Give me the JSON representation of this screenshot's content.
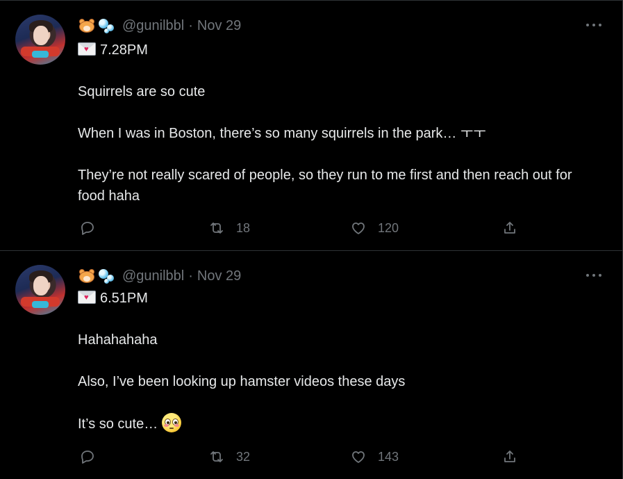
{
  "tweets": [
    {
      "handle": "@gunilbbl",
      "separator": "·",
      "date": "Nov 29",
      "time_label": "7.28PM",
      "lines": [
        "Squirrels are so cute",
        "When I was in Boston, there’s so many squirrels in the park… ㅜㅜ",
        "They’re not really scared of people, so they run to me first and then reach out for food haha"
      ],
      "retweets": "18",
      "likes": "120"
    },
    {
      "handle": "@gunilbbl",
      "separator": "·",
      "date": "Nov 29",
      "time_label": "6.51PM",
      "lines": [
        "Hahahahaha",
        "Also, I’ve been looking up hamster videos these days",
        "It’s so cute…"
      ],
      "retweets": "32",
      "likes": "143"
    }
  ],
  "icons": {
    "name_emojis": [
      "hamster-face-icon",
      "bubbles-icon"
    ],
    "time_emoji": "love-letter-icon",
    "end_emoji": "flushed-face-icon",
    "actions": [
      "reply-icon",
      "retweet-icon",
      "like-icon",
      "share-icon"
    ]
  },
  "colors": {
    "background": "#000000",
    "text": "#e7e9ea",
    "muted": "#71767b",
    "divider": "#2f3336"
  }
}
